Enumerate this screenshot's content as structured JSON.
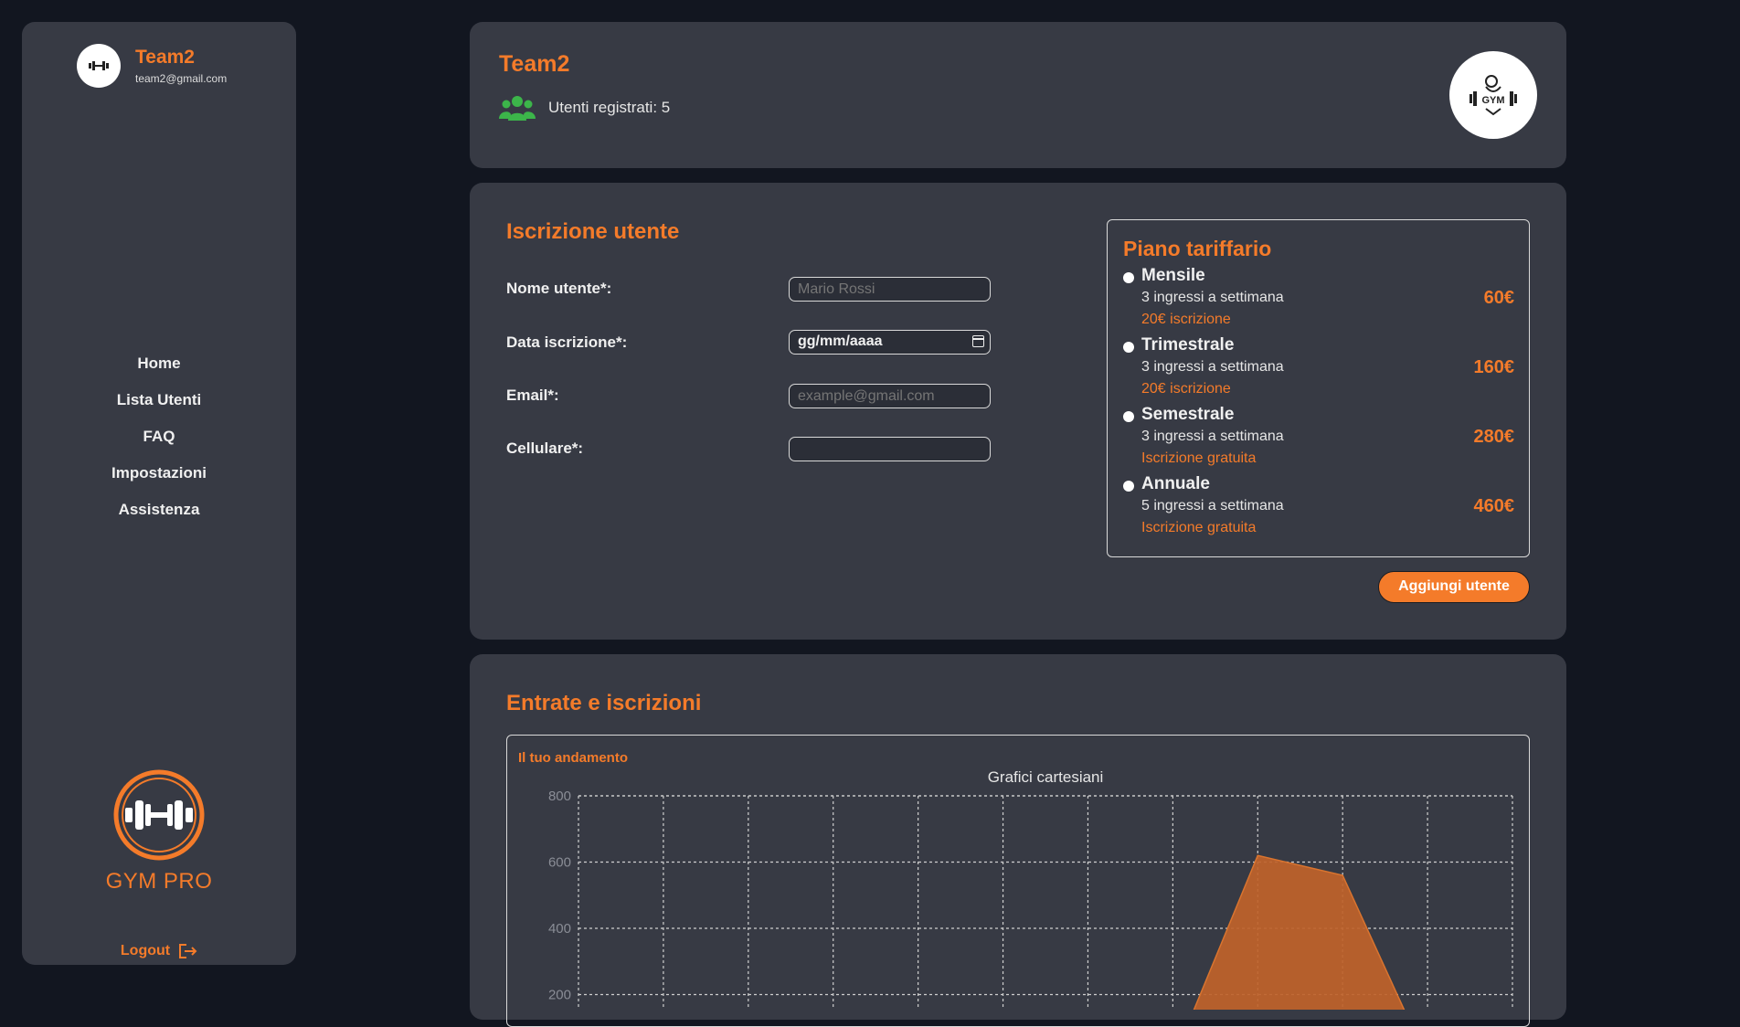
{
  "sidebar": {
    "profile": {
      "name": "Team2",
      "email": "team2@gmail.com"
    },
    "nav": [
      "Home",
      "Lista Utenti",
      "FAQ",
      "Impostazioni",
      "Assistenza"
    ],
    "brand": "GYM PRO",
    "logout": "Logout"
  },
  "header": {
    "title": "Team2",
    "users_label": "Utenti registrati: 5",
    "logo_text": "GYM"
  },
  "form": {
    "title": "Iscrizione utente",
    "fields": [
      {
        "label": "Nome utente*:",
        "placeholder": "Mario Rossi"
      },
      {
        "label": "Data iscrizione*:",
        "value": "gg/mm/aaaa"
      },
      {
        "label": "Email*:",
        "placeholder": "example@gmail.com"
      },
      {
        "label": "Cellulare*:",
        "placeholder": ""
      }
    ],
    "plans_title": "Piano tariffario",
    "plans": [
      {
        "name": "Mensile",
        "desc": "3 ingressi a settimana",
        "fee": "20€ iscrizione",
        "price": "60€"
      },
      {
        "name": "Trimestrale",
        "desc": "3 ingressi a settimana",
        "fee": "20€ iscrizione",
        "price": "160€"
      },
      {
        "name": "Semestrale",
        "desc": "3 ingressi a settimana",
        "fee": "Iscrizione gratuita",
        "price": "280€"
      },
      {
        "name": "Annuale",
        "desc": "5 ingressi a settimana",
        "fee": "Iscrizione gratuita",
        "price": "460€"
      }
    ],
    "submit": "Aggiungi utente"
  },
  "chart_section": {
    "title": "Entrate e iscrizioni",
    "subtitle": "Il tuo andamento"
  },
  "colors": {
    "accent": "#f47b2a",
    "card": "#373a44",
    "background": "#121620",
    "users_icon": "#3cb54a"
  },
  "chart_data": {
    "type": "area",
    "title": "Grafici cartesiani",
    "xlabel": "",
    "ylabel": "",
    "y_ticks": [
      200,
      400,
      600,
      800
    ],
    "ylim": [
      0,
      800
    ],
    "grid": true,
    "x": [
      0,
      1,
      2,
      3,
      4,
      5,
      6,
      7,
      8,
      9,
      10,
      11
    ],
    "series": [
      {
        "values": [
          0,
          0,
          0,
          0,
          0,
          0,
          0,
          0,
          620,
          560,
          0,
          0
        ]
      }
    ]
  }
}
